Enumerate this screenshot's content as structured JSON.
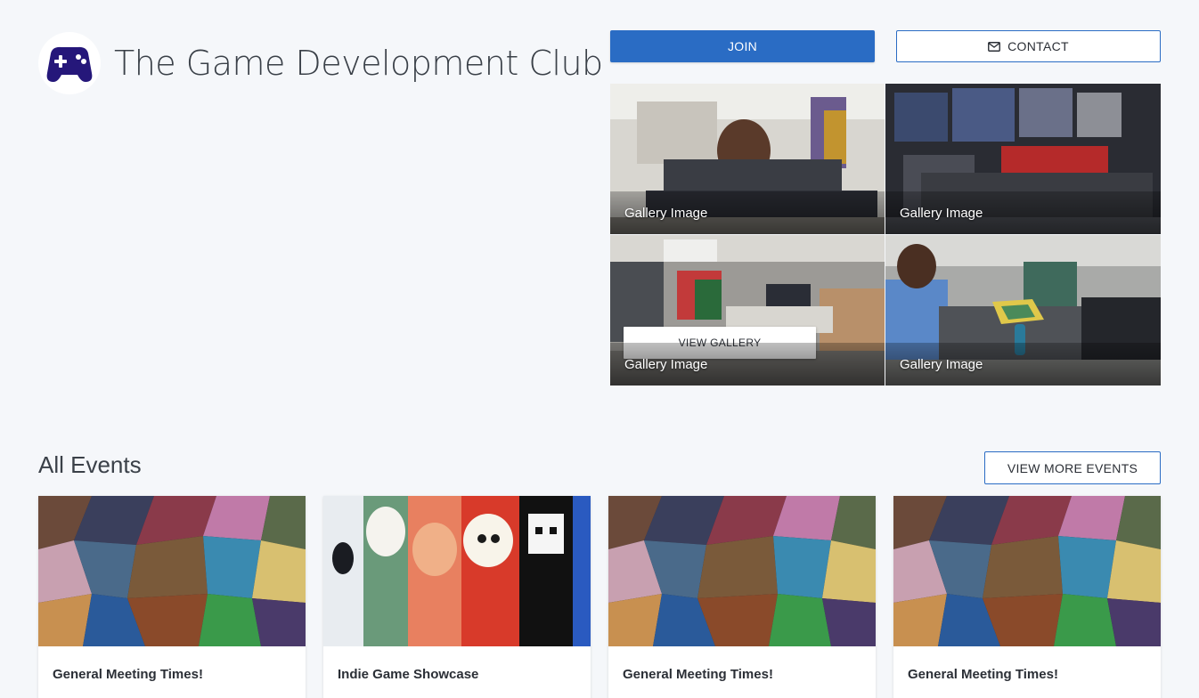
{
  "header": {
    "club_name": "The Game Development Club",
    "logo_icon": "gamepad-icon",
    "join_label": "JOIN",
    "contact_label": "CONTACT",
    "contact_icon": "envelope-icon"
  },
  "gallery": {
    "tiles": [
      {
        "caption": "Gallery Image"
      },
      {
        "caption": "Gallery Image"
      },
      {
        "caption": "Gallery Image"
      },
      {
        "caption": "Gallery Image"
      }
    ],
    "view_gallery_label": "VIEW GALLERY"
  },
  "events": {
    "heading": "All Events",
    "view_more_label": "VIEW MORE EVENTS",
    "items": [
      {
        "title": "General Meeting Times!"
      },
      {
        "title": "Indie Game Showcase"
      },
      {
        "title": "General Meeting Times!"
      },
      {
        "title": "General Meeting Times!"
      }
    ]
  },
  "colors": {
    "accent": "#2a6cc4",
    "logo": "#25177a",
    "background": "#f5f7fa"
  }
}
